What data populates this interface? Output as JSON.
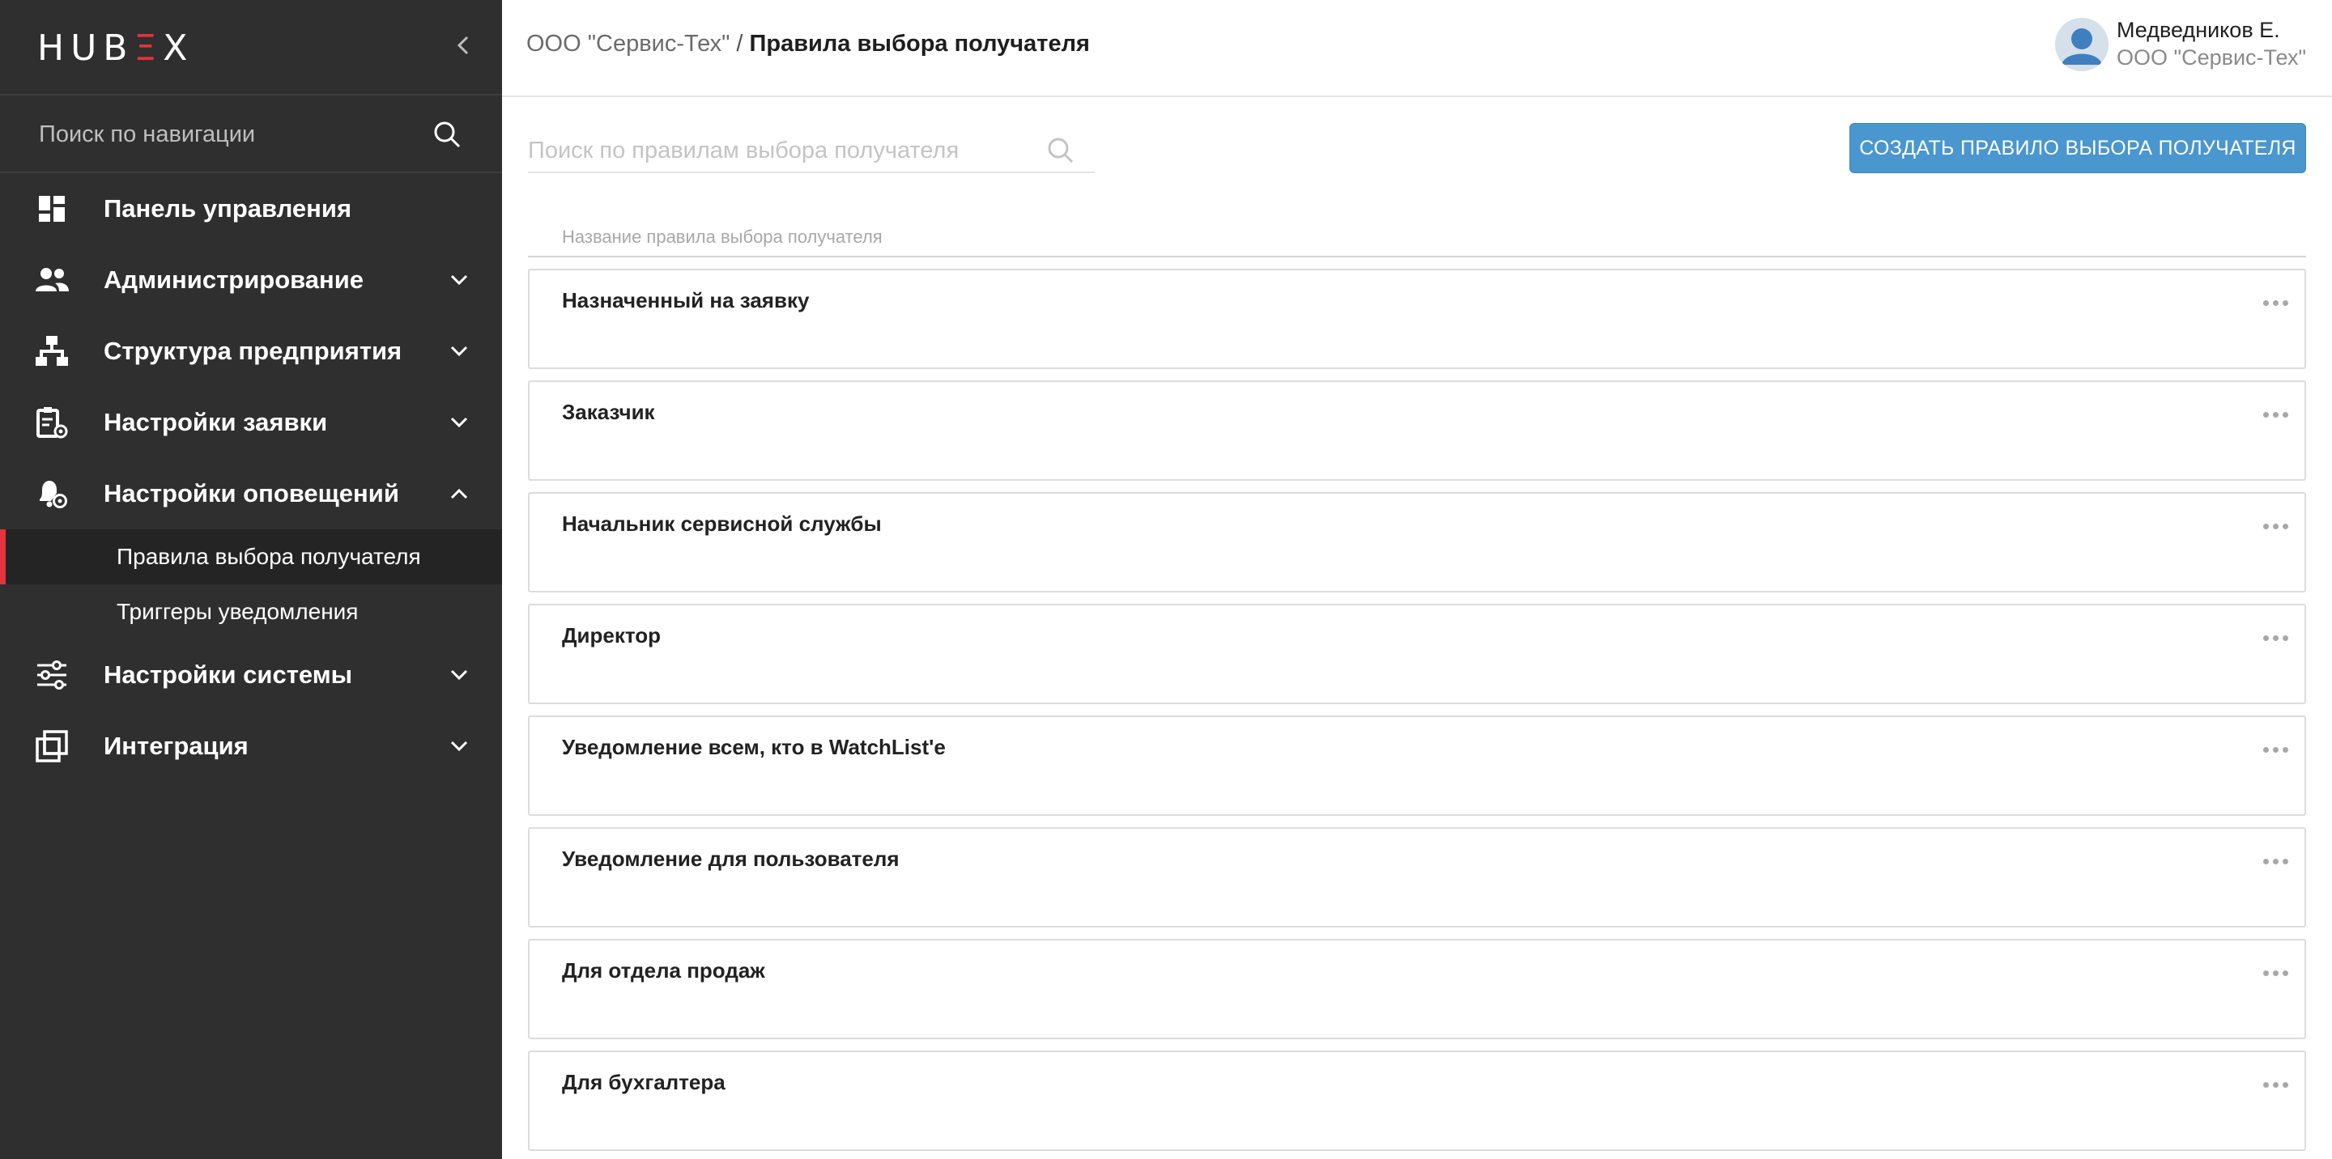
{
  "logo": {
    "part1": "HUB",
    "accent": "Ξ",
    "part2": "X"
  },
  "nav_search": {
    "placeholder": "Поиск по навигации"
  },
  "sidebar": {
    "items": [
      {
        "label": "Панель управления",
        "icon": "dashboard-icon"
      },
      {
        "label": "Администрирование",
        "icon": "users-icon",
        "expanded": false
      },
      {
        "label": "Структура предприятия",
        "icon": "org-structure-icon",
        "expanded": false
      },
      {
        "label": "Настройки заявки",
        "icon": "clipboard-settings-icon",
        "expanded": false
      },
      {
        "label": "Настройки оповещений",
        "icon": "bell-settings-icon",
        "expanded": true
      },
      {
        "label": "Настройки системы",
        "icon": "sliders-icon",
        "expanded": false
      },
      {
        "label": "Интеграция",
        "icon": "integration-icon",
        "expanded": false
      }
    ],
    "subitems": [
      {
        "label": "Правила выбора получателя",
        "active": true
      },
      {
        "label": "Триггеры уведомления",
        "active": false
      }
    ]
  },
  "header": {
    "breadcrumb_company": "ООО \"Сервис-Тех\"",
    "breadcrumb_separator": " / ",
    "breadcrumb_current": "Правила выбора получателя",
    "user_name": "Медведников Е.",
    "user_org": "ООО \"Сервис-Тех\""
  },
  "main": {
    "search_placeholder": "Поиск по правилам выбора получателя",
    "create_button": "СОЗДАТЬ ПРАВИЛО ВЫБОРА ПОЛУЧАТЕЛЯ",
    "column_name": "Название правила выбора получателя",
    "rules": [
      "Назначенный на заявку",
      "Заказчик",
      "Начальник сервисной службы",
      "Директор",
      "Уведомление всем, кто в WatchList'e",
      "Уведомление для пользователя",
      "Для отдела продаж",
      "Для бухгалтера"
    ]
  },
  "colors": {
    "sidebar_bg": "#2f2f2f",
    "accent_red": "#e5323e",
    "primary_button": "#4a96cf"
  }
}
